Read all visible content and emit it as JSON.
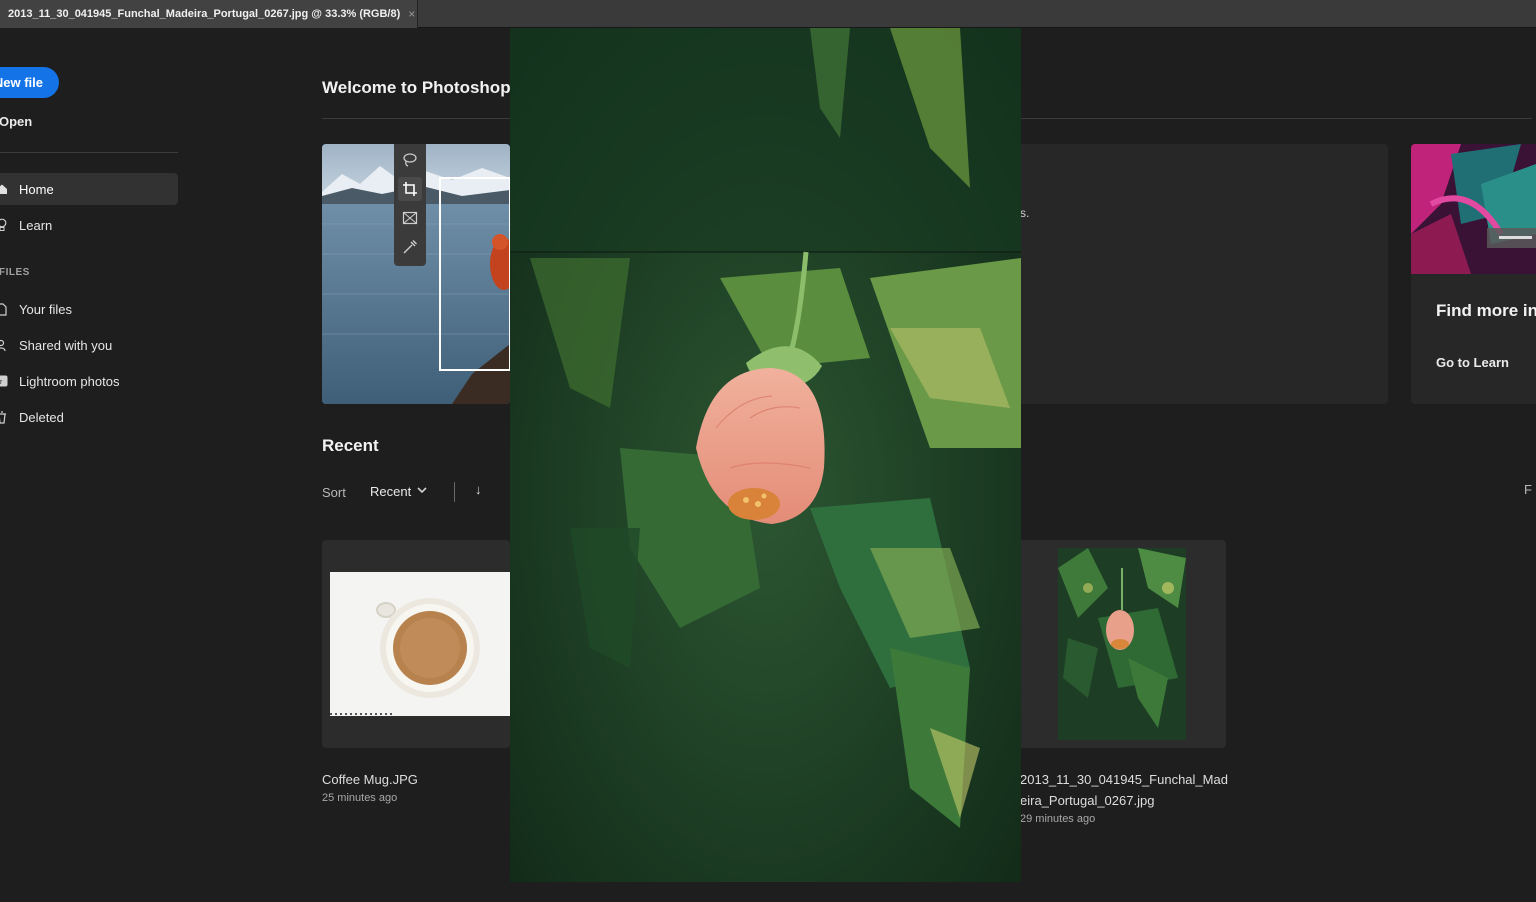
{
  "document_tab": {
    "title": "2013_11_30_041945_Funchal_Madeira_Portugal_0267.jpg @ 33.3% (RGB/8)",
    "close_symbol": "×"
  },
  "sidebar": {
    "new_file_label": "New file",
    "open_label": "Open",
    "items": [
      {
        "label": "Home",
        "icon": "home-icon",
        "active": true
      },
      {
        "label": "Learn",
        "icon": "lightbulb-icon",
        "active": false
      }
    ],
    "files_section_label": "FILES",
    "file_items": [
      {
        "label": "Your files",
        "icon": "file-icon"
      },
      {
        "label": "Shared with you",
        "icon": "people-icon"
      },
      {
        "label": "Lightroom photos",
        "icon": "lightroom-icon"
      },
      {
        "label": "Deleted",
        "icon": "trash-icon"
      }
    ]
  },
  "main": {
    "welcome_title": "Welcome to Photoshop, T",
    "promo_text_fragment": "s.",
    "learn_card": {
      "title": "Find more in",
      "link": "Go to Learn"
    },
    "tools": [
      "lasso-icon",
      "crop-icon",
      "frame-icon",
      "eyedropper-icon"
    ],
    "recent": {
      "title": "Recent",
      "sort_label": "Sort",
      "sort_value": "Recent",
      "sort_direction_symbol": "↓",
      "filter_edge": "F",
      "files": [
        {
          "name": "Coffee Mug.JPG",
          "time": "25 minutes ago"
        },
        {
          "name": "2013_11_30_041945_Funchal_Madeira_Portugal_0267.jpg",
          "time": "29 minutes ago"
        }
      ]
    }
  },
  "colors": {
    "accent": "#1473e6",
    "background": "#1e1e1e",
    "card": "#2c2c2c",
    "tab_bar": "#3a3a3a"
  }
}
